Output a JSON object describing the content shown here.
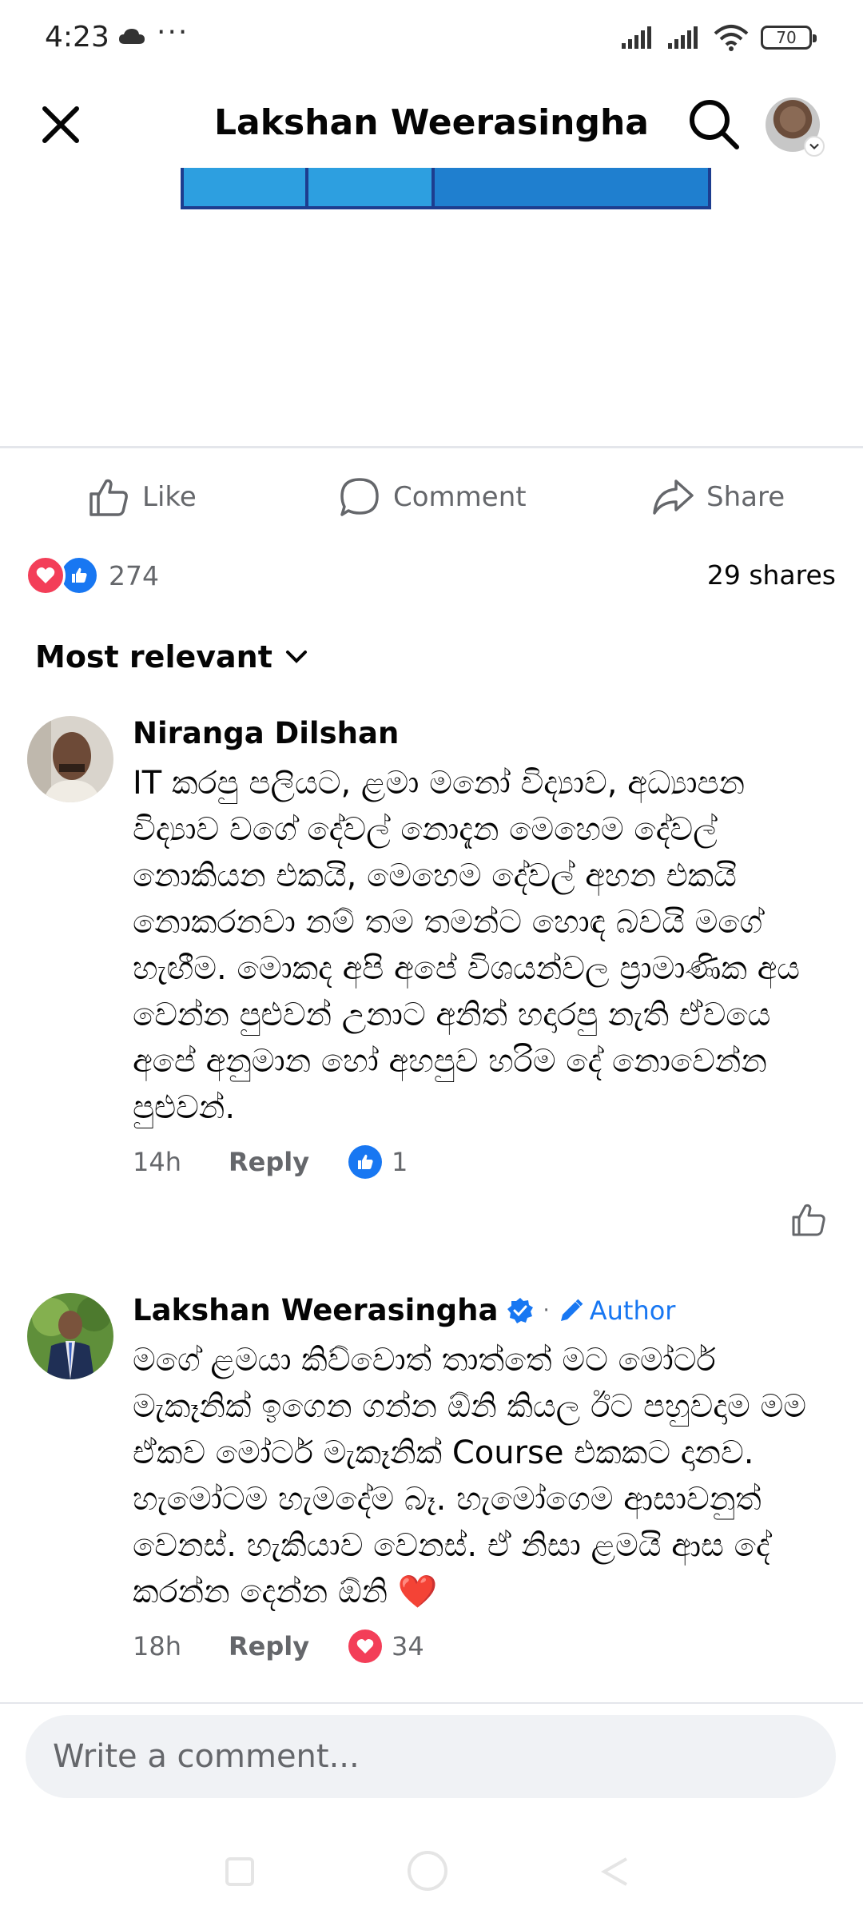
{
  "status_bar": {
    "time": "4:23",
    "more": "···",
    "battery": "70"
  },
  "header": {
    "title": "Lakshan Weerasingha"
  },
  "actions": {
    "like": "Like",
    "comment": "Comment",
    "share": "Share"
  },
  "reactions": {
    "count": "274",
    "shares": "29 shares"
  },
  "sort": {
    "label": "Most relevant"
  },
  "comments": [
    {
      "name": "Niranga Dilshan",
      "text": "IT කරපු පලියට, ළමා මනෝ විද්‍යාව, අධ්‍යාපන විද්‍යාව වගේ දේවල් නොදැන මෙහෙම දේවල් නොකියන එකයි, මෙහෙම දේවල් අහන එකයි නොකරනවා නම් තම තමන්ට හොඳ බවයි මගේ හැඟීම. මොකද අපි අපේ විශයන්වල ප්‍රාමාණික අය වෙන්න පුළුවන් උනාට අනිත් හදාරපු නැති ඒවයෙ අපේ අනුමාන හෝ අහපුව හරිම දේ නොවෙන්න පුළුවන්.",
      "time": "14h",
      "reply": "Reply",
      "likes": "1"
    },
    {
      "name": "Lakshan Weerasingha",
      "author_label": "Author",
      "text": "මගේ ළමයා කිව්වොත් තාත්තේ මට මෝටර් මැකෑනික් ඉගෙන ගන්න ඕනි කියල ඊට පහුවදාම මම ඒකව මෝටර් මැකෑනික් Course එකකට දානව. හැමෝටම හැමදේම බෑ. හැමෝගෙම ආසාවනුත් වෙනස්. හැකියාව වෙනස්. ඒ නිසා ළමයි ආස දේ කරන්න දෙන්න ඕනි ❤️",
      "time": "18h",
      "reply": "Reply",
      "likes": "34"
    }
  ],
  "composer": {
    "placeholder": "Write a comment..."
  },
  "colors": {
    "accent": "#1877f2",
    "love": "#f33e58",
    "muted": "#65676b"
  }
}
